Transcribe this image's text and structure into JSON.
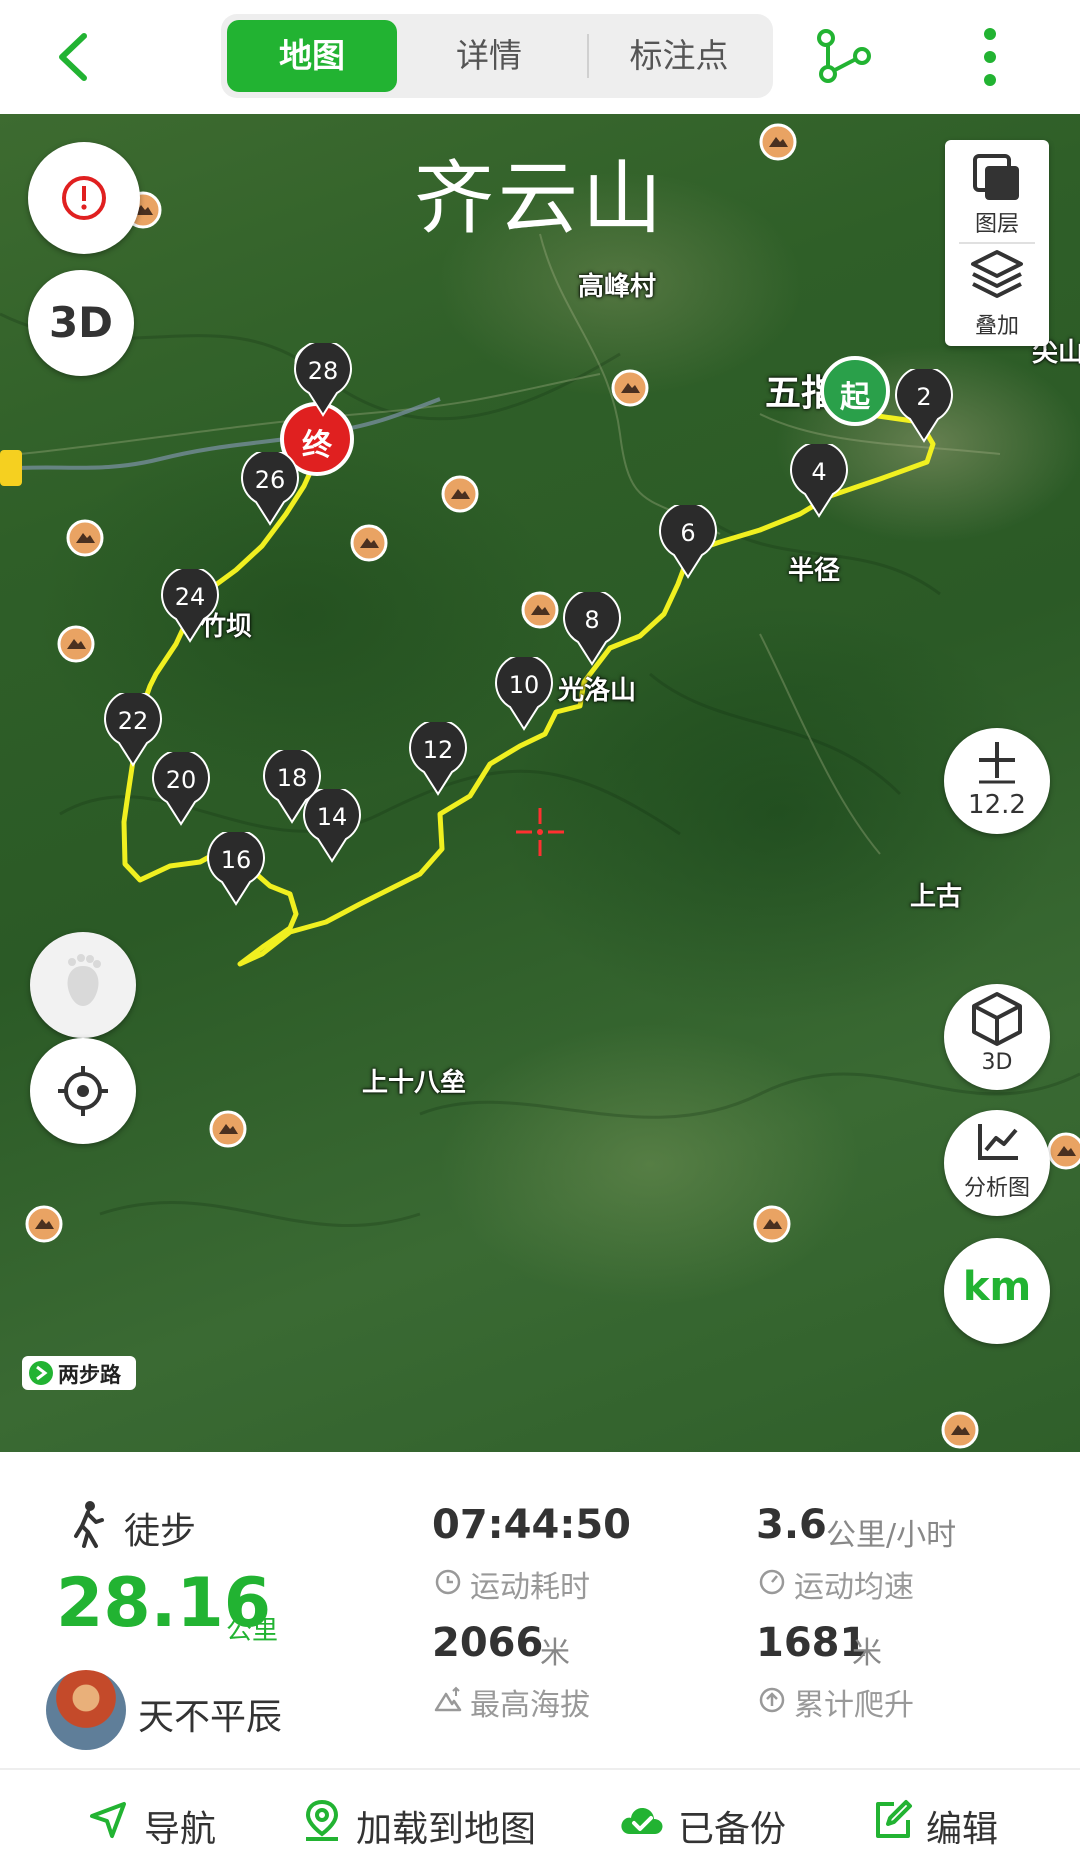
{
  "header": {
    "tabs": [
      {
        "label": "地图",
        "active": true
      },
      {
        "label": "详情",
        "active": false
      },
      {
        "label": "标注点",
        "active": false
      }
    ]
  },
  "map": {
    "title": "齐云山",
    "places": [
      {
        "label": "高峰村"
      },
      {
        "label": "五指乡"
      },
      {
        "label": "尖山"
      },
      {
        "label": "半径"
      },
      {
        "label": "光洛山"
      },
      {
        "label": "竹坝"
      },
      {
        "label": "上十八垒"
      },
      {
        "label": "上古"
      }
    ],
    "start_label": "起",
    "end_label": "终",
    "waypoints": [
      "2",
      "4",
      "6",
      "8",
      "10",
      "12",
      "14",
      "16",
      "18",
      "20",
      "22",
      "24",
      "26",
      "28"
    ],
    "layer_buttons": {
      "layer_label": "图层",
      "overlay_label": "叠加"
    },
    "zoom_level": "12.2",
    "view_3d_label": "3D",
    "analysis_label": "分析图",
    "unit_label": "km",
    "brand_label": "两步路",
    "left_3d_label": "3D",
    "route_color": "#f0f020",
    "accent_color": "#22b332"
  },
  "stats": {
    "activity_type": "徒步",
    "distance": "28.16",
    "distance_unit": "公里",
    "duration": "07:44:50",
    "duration_label": "运动耗时",
    "avg_speed": "3.6",
    "avg_speed_unit": "公里/小时",
    "avg_speed_label": "运动均速",
    "max_altitude": "2066",
    "max_altitude_unit": "米",
    "max_altitude_label": "最高海拔",
    "total_climb": "1681",
    "total_climb_unit": "米",
    "total_climb_label": "累计爬升",
    "username": "天不平辰"
  },
  "bottom_bar": {
    "navigate": "导航",
    "load_to_map": "加载到地图",
    "backed_up": "已备份",
    "edit": "编辑"
  }
}
